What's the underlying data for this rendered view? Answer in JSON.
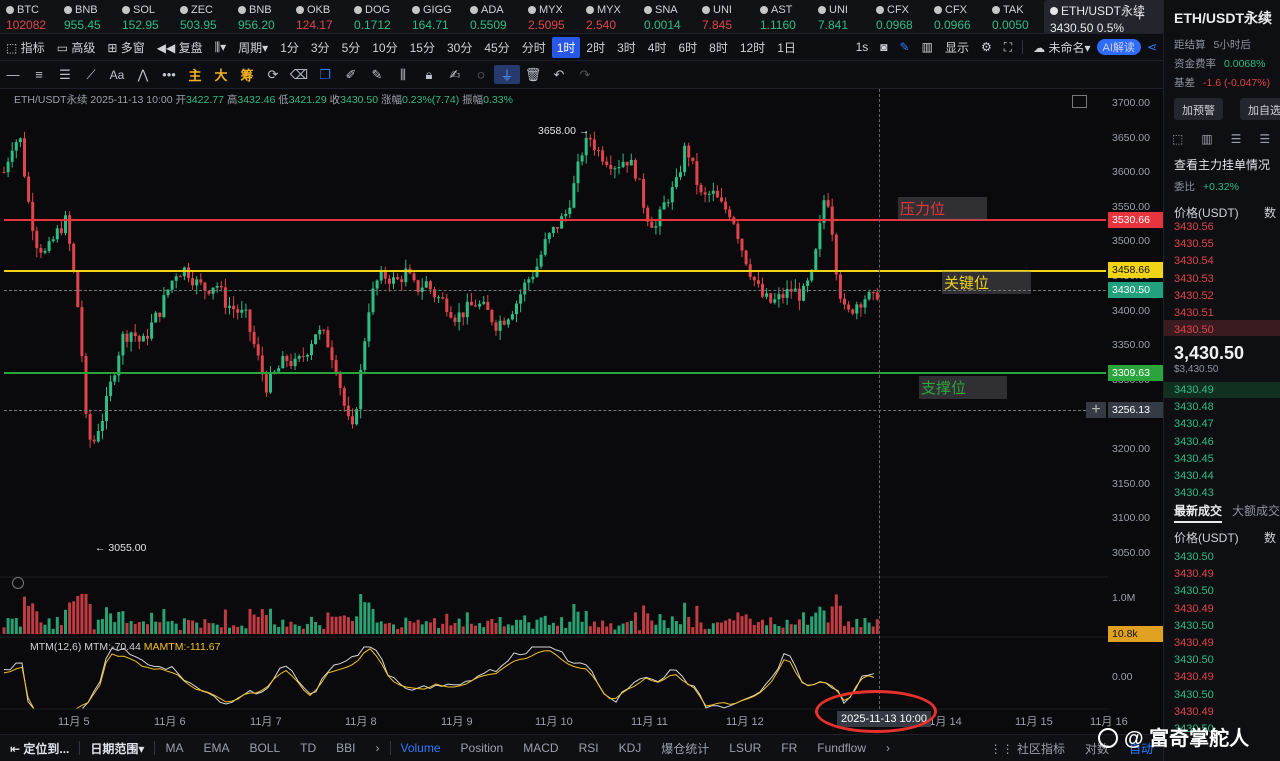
{
  "ticker": [
    {
      "sym": "BTC",
      "val": "102082",
      "dir": "down"
    },
    {
      "sym": "BNB",
      "val": "955.45",
      "dir": "up"
    },
    {
      "sym": "SOL",
      "val": "152.95",
      "dir": "up"
    },
    {
      "sym": "ZEC",
      "val": "503.95",
      "dir": "up"
    },
    {
      "sym": "BNB",
      "val": "956.20",
      "dir": "up"
    },
    {
      "sym": "OKB",
      "val": "124.17",
      "dir": "down"
    },
    {
      "sym": "DOG",
      "val": "0.1712",
      "dir": "up"
    },
    {
      "sym": "GIGG",
      "val": "164.71",
      "dir": "up"
    },
    {
      "sym": "ADA",
      "val": "0.5509",
      "dir": "up"
    },
    {
      "sym": "MYX",
      "val": "2.5095",
      "dir": "down"
    },
    {
      "sym": "MYX",
      "val": "2.540",
      "dir": "down"
    },
    {
      "sym": "SNA",
      "val": "0.0014",
      "dir": "up"
    },
    {
      "sym": "UNI",
      "val": "7.845",
      "dir": "down"
    },
    {
      "sym": "AST",
      "val": "1.1160",
      "dir": "up"
    },
    {
      "sym": "UNI",
      "val": "7.841",
      "dir": "up"
    },
    {
      "sym": "CFX",
      "val": "0.0968",
      "dir": "up"
    },
    {
      "sym": "CFX",
      "val": "0.0966",
      "dir": "up"
    },
    {
      "sym": "TAK",
      "val": "0.0050",
      "dir": "up"
    }
  ],
  "active_tab": {
    "sym": "ETH/USDT永续",
    "price": "3430.50",
    "pct": "0.5%"
  },
  "toolbar1": {
    "items": [
      "指标",
      "高级",
      "多窗",
      "复盘",
      "周期",
      "1分",
      "3分",
      "5分",
      "10分",
      "15分",
      "30分",
      "45分",
      "分时",
      "1时",
      "2时",
      "3时",
      "4时",
      "6时",
      "8时",
      "12时",
      "1日"
    ],
    "selected": "1时",
    "right": [
      "1s",
      "显示",
      "未命名",
      "AI解读"
    ]
  },
  "toolbar2": {
    "cn_labels": [
      "主",
      "大",
      "筹"
    ]
  },
  "ohlc": {
    "symbol": "ETH/USDT永续",
    "time": "2025-11-13 10:00",
    "open_label": "开",
    "open": "3422.77",
    "high_label": "高",
    "high": "3432.46",
    "low_label": "低",
    "low": "3421.29",
    "close_label": "收",
    "close": "3430.50",
    "chg_label": "涨幅",
    "chg": "0.23%(7.74)",
    "amp_label": "振幅",
    "amp": "0.33%"
  },
  "price_axis": [
    "3700.00",
    "3650.00",
    "3600.00",
    "3550.00",
    "3500.00",
    "3450.00",
    "3400.00",
    "3350.00",
    "3300.00",
    "3250.00",
    "3200.00",
    "3150.00",
    "3100.00",
    "3050.00"
  ],
  "volume_axis": [
    "1.0M",
    "0.00"
  ],
  "lines": {
    "resistance": {
      "label": "压力位",
      "price": "3530.66",
      "color": "#e8343c"
    },
    "key": {
      "label": "关键位",
      "price": "3458.66",
      "color": "#f1d318"
    },
    "support": {
      "label": "支撑位",
      "price": "3309.63",
      "color": "#2ba43b"
    },
    "last": {
      "price": "3430.50",
      "color": "#21a27c"
    },
    "cursor": {
      "price": "3256.13"
    }
  },
  "extremes": {
    "high": "3658.00",
    "low": "3055.00"
  },
  "volume_tag": "10.8k",
  "mtm": {
    "name": "MTM(12,6)",
    "mtm_label": "MTM:",
    "mtm": "-70.44",
    "mamtm_label": "MAMTM:",
    "mamtm": "-111.67"
  },
  "dates": [
    "11月 5",
    "11月 6",
    "11月 7",
    "11月 8",
    "11月 9",
    "11月 10",
    "11月 11",
    "11月 12",
    "11月 14",
    "11月 15",
    "11月 16"
  ],
  "cursor_date": "2025-11-13 10:00",
  "bottom": {
    "left": [
      "定位到...",
      "日期范围"
    ],
    "indicators": [
      "MA",
      "EMA",
      "BOLL",
      "TD",
      "BBI",
      "Volume",
      "Position",
      "MACD",
      "RSI",
      "KDJ",
      "爆仓统计",
      "LSUR",
      "FR",
      "Fundflow"
    ],
    "active": "Volume",
    "right": [
      "社区指标",
      "对数",
      "自动"
    ]
  },
  "right_panel": {
    "title": "ETH/USDT永续",
    "settle_label": "距结算",
    "settle": "5小时后",
    "funding_label": "资金费率",
    "funding": "0.0068%",
    "basis_label": "基差",
    "basis": "-1.6 (-0.047%)",
    "btn_alert": "加预警",
    "btn_fav": "加自选",
    "orderbook_title": "查看主力挂单情况",
    "ratio_label": "委比",
    "ratio": "+0.32%",
    "price_hdr": "价格(USDT)",
    "qty_hdr": "数",
    "asks": [
      "3430.56",
      "3430.55",
      "3430.54",
      "3430.53",
      "3430.52",
      "3430.51",
      "3430.50"
    ],
    "last_price": "3,430.50",
    "last_price_sub": "$3,430.50",
    "bids": [
      "3430.49",
      "3430.48",
      "3430.47",
      "3430.46",
      "3430.45",
      "3430.44",
      "3430.43"
    ],
    "trades_tab": "最新成交",
    "big_trades_tab": "大额成交",
    "trades": [
      {
        "p": "3430.50",
        "d": "up"
      },
      {
        "p": "3430.49",
        "d": "down"
      },
      {
        "p": "3430.50",
        "d": "up"
      },
      {
        "p": "3430.49",
        "d": "down"
      },
      {
        "p": "3430.50",
        "d": "up"
      },
      {
        "p": "3430.49",
        "d": "down"
      },
      {
        "p": "3430.50",
        "d": "up"
      },
      {
        "p": "3430.49",
        "d": "down"
      },
      {
        "p": "3430.50",
        "d": "up"
      },
      {
        "p": "3430.49",
        "d": "down"
      },
      {
        "p": "3430.50",
        "d": "up"
      }
    ]
  },
  "watermark": "富奇掌舵人",
  "watermark_prefix": "@"
}
